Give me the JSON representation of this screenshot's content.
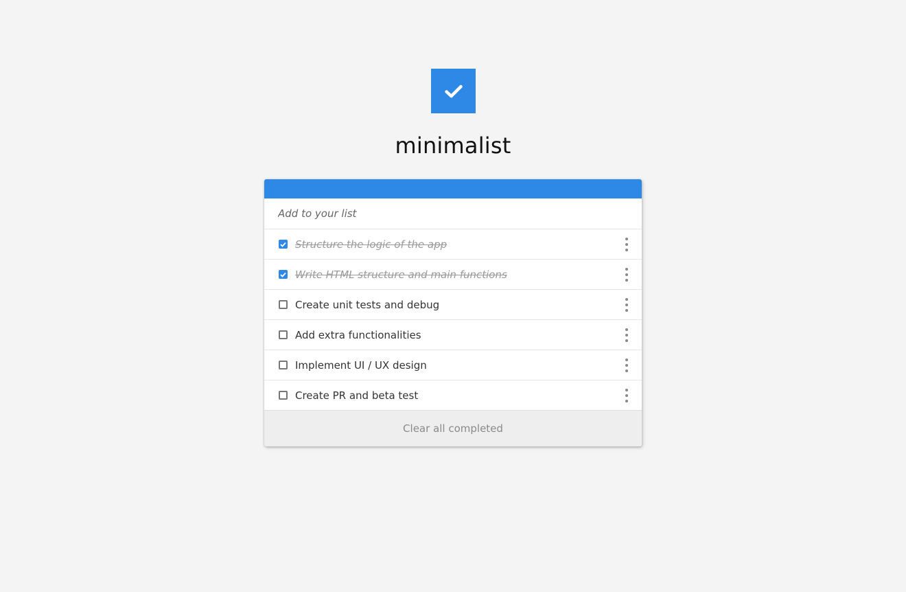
{
  "app": {
    "title": "minimalist",
    "logo_icon": "check-icon",
    "accent_color": "#2e89e6"
  },
  "input": {
    "placeholder": "Add to your list",
    "value": ""
  },
  "todos": [
    {
      "text": "Structure the logic of the app",
      "completed": true
    },
    {
      "text": "Write HTML structure and main functions",
      "completed": true
    },
    {
      "text": "Create unit tests and debug",
      "completed": false
    },
    {
      "text": "Add extra functionalities",
      "completed": false
    },
    {
      "text": "Implement UI / UX design",
      "completed": false
    },
    {
      "text": "Create PR and beta test",
      "completed": false
    }
  ],
  "footer": {
    "clear_label": "Clear all completed"
  }
}
